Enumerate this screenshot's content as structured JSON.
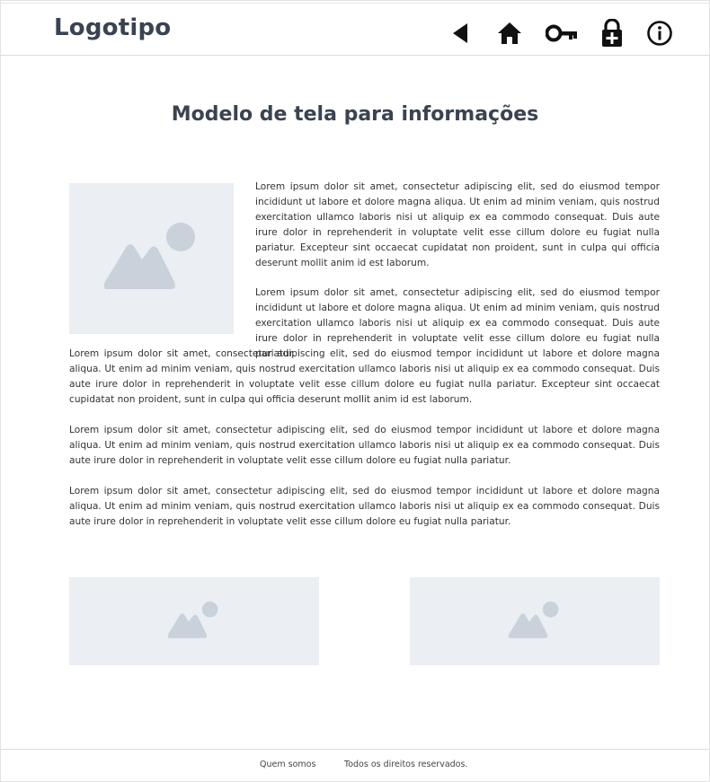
{
  "header": {
    "logo": "Logotipo",
    "icons": [
      "back-icon",
      "home-icon",
      "key-icon",
      "lock-add-icon",
      "info-icon"
    ]
  },
  "main": {
    "title": "Modelo de tela para informações",
    "paragraphs": [
      "Lorem ipsum dolor sit amet, consectetur adipiscing elit, sed do eiusmod tempor incididunt ut labore et dolore magna aliqua. Ut enim ad minim veniam, quis nostrud exercitation ullamco laboris nisi ut aliquip ex ea commodo consequat. Duis aute irure dolor in reprehenderit in voluptate velit esse cillum dolore eu fugiat nulla pariatur. Excepteur sint occaecat cupidatat non proident, sunt in culpa qui officia deserunt mollit anim id est laborum.",
      "Lorem ipsum dolor sit amet, consectetur adipiscing elit, sed do eiusmod tempor incididunt ut labore et dolore magna aliqua. Ut enim ad minim veniam, quis nostrud exercitation ullamco laboris nisi ut aliquip ex ea commodo consequat. Duis aute irure dolor in reprehenderit in voluptate velit esse cillum dolore eu fugiat nulla pariatur.",
      "Lorem ipsum dolor sit amet, consectetur adipiscing elit, sed do eiusmod tempor incididunt ut labore et dolore magna aliqua. Ut enim ad minim veniam, quis nostrud exercitation ullamco laboris nisi ut aliquip ex ea commodo consequat. Duis aute irure dolor in reprehenderit in voluptate velit esse cillum dolore eu fugiat nulla pariatur. Excepteur sint occaecat cupidatat non proident, sunt in culpa qui officia deserunt mollit anim id est laborum.",
      "Lorem ipsum dolor sit amet, consectetur adipiscing elit, sed do eiusmod tempor incididunt ut labore et dolore magna aliqua. Ut enim ad minim veniam, quis nostrud exercitation ullamco laboris nisi ut aliquip ex ea commodo consequat. Duis aute irure dolor in reprehenderit in voluptate velit esse cillum dolore eu fugiat nulla pariatur.",
      "Lorem ipsum dolor sit amet, consectetur adipiscing elit, sed do eiusmod tempor incididunt ut labore et dolore magna aliqua. Ut enim ad minim veniam, quis nostrud exercitation ullamco laboris nisi ut aliquip ex ea commodo consequat. Duis aute irure dolor in reprehenderit in voluptate velit esse cillum dolore eu fugiat nulla pariatur."
    ]
  },
  "footer": {
    "about": "Quem somos",
    "rights": "Todos os direitos reservados."
  },
  "colors": {
    "title": "#3a4350",
    "placeholder_bg": "#ebeef2",
    "placeholder_icon": "#c9d2db"
  }
}
